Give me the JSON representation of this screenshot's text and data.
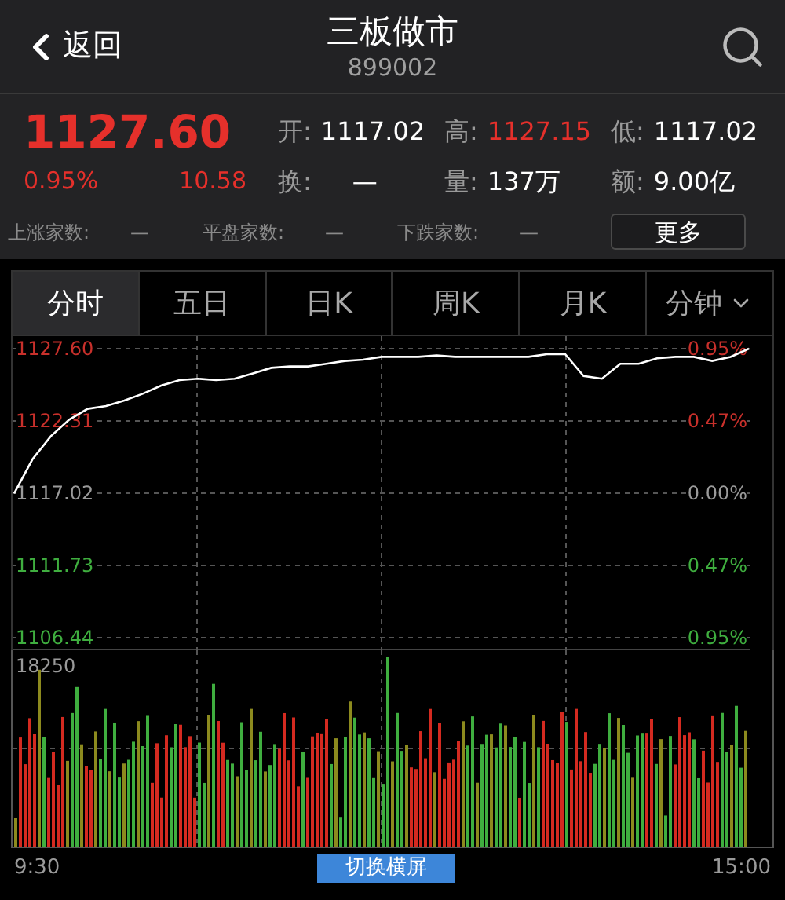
{
  "header": {
    "back": "返回",
    "title": "三板做市",
    "code": "899002"
  },
  "quote": {
    "price": "1127.60",
    "change_percent": "0.95%",
    "change": "10.58",
    "color": "#e5302b"
  },
  "stats": [
    {
      "label": "开:",
      "value": "1117.02",
      "color": "#ffffff"
    },
    {
      "label": "高:",
      "value": "1127.15",
      "color": "#e5302b"
    },
    {
      "label": "低:",
      "value": "1117.02",
      "color": "#ffffff"
    },
    {
      "label": "换:",
      "value": "—",
      "color": "#ffffff"
    },
    {
      "label": "量:",
      "value": "137万",
      "color": "#ffffff"
    },
    {
      "label": "额:",
      "value": "9.00亿",
      "color": "#ffffff"
    }
  ],
  "breadth": [
    {
      "label": "上涨家数:",
      "value": "—"
    },
    {
      "label": "平盘家数:",
      "value": "—"
    },
    {
      "label": "下跌家数:",
      "value": "—"
    }
  ],
  "more_button": "更多",
  "tabs": [
    {
      "label": "分时",
      "selected": true,
      "kind": "tab"
    },
    {
      "label": "五日",
      "selected": false,
      "kind": "tab"
    },
    {
      "label": "日K",
      "selected": false,
      "kind": "tab"
    },
    {
      "label": "周K",
      "selected": false,
      "kind": "tab"
    },
    {
      "label": "月K",
      "selected": false,
      "kind": "tab"
    },
    {
      "label": "分钟",
      "selected": false,
      "kind": "dropdown"
    }
  ],
  "price_chart": {
    "levels": [
      {
        "percent": "0.95%",
        "color": "#c8302b"
      },
      {
        "percent": "0.47%",
        "color": "#c8302b"
      },
      {
        "percent": "0.00%",
        "color": "#9a9a9a"
      },
      {
        "percent": "0.47%",
        "color": "#3fae3f"
      },
      {
        "percent": "0.95%",
        "color": "#3fae3f"
      }
    ],
    "chart_data": {
      "type": "line",
      "ylim": [
        1106.44,
        1127.6
      ],
      "yticks": [
        {
          "value": 1127.6,
          "label": "1127.60"
        },
        {
          "value": 1122.31,
          "label": "1122.31"
        },
        {
          "value": 1117.02,
          "label": "1117.02"
        },
        {
          "value": 1111.73,
          "label": "1111.73"
        },
        {
          "value": 1106.44,
          "label": "1106.44"
        }
      ],
      "grid": true,
      "series": [
        {
          "color": "#ffffff",
          "values": [
            1117.0,
            1119.5,
            1121.2,
            1122.4,
            1123.2,
            1123.4,
            1123.8,
            1124.3,
            1124.9,
            1125.3,
            1125.4,
            1125.3,
            1125.4,
            1125.8,
            1126.2,
            1126.3,
            1126.3,
            1126.5,
            1126.7,
            1126.8,
            1127.0,
            1127.0,
            1127.0,
            1127.1,
            1127.0,
            1127.0,
            1127.0,
            1127.0,
            1127.0,
            1127.2,
            1127.2,
            1125.6,
            1125.4,
            1126.5,
            1126.5,
            1126.9,
            1127.0,
            1127.0,
            1126.7,
            1127.0,
            1127.6
          ]
        }
      ]
    }
  },
  "volume_chart": {
    "max_label": "18250"
  },
  "time_axis": {
    "start": "9:30",
    "end": "15:00"
  },
  "rotate_button": "切换横屏"
}
